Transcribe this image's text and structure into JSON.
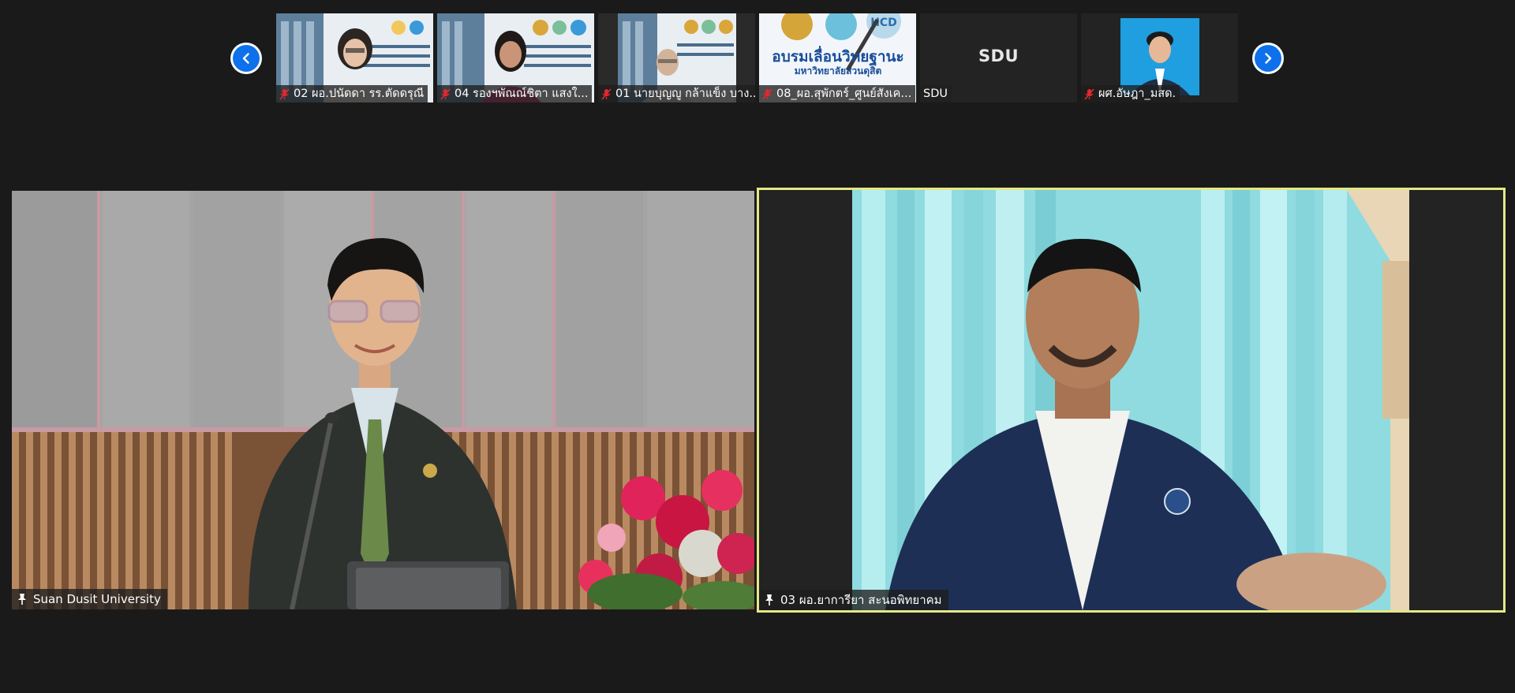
{
  "strip": {
    "prev_label": "Previous",
    "next_label": "Next",
    "thumbnails": [
      {
        "name": "02 ผอ.ปนัดดา รร.ตัดดรุณี",
        "muted": true,
        "type": "video"
      },
      {
        "name": "04 รองฯพัณณ์ชิตา  แสงใ...",
        "muted": true,
        "type": "video"
      },
      {
        "name": "01 นายบุญญู กล้าแข็ง บาง...",
        "muted": true,
        "type": "video"
      },
      {
        "name": "08_ผอ.สุพักตร์_ศูนย์สังเค...",
        "muted": true,
        "type": "video"
      },
      {
        "name": "SDU",
        "muted": false,
        "type": "avatar",
        "avatar_text": "SDU"
      },
      {
        "name": "ผศ.อัษฎา_มสด.",
        "muted": true,
        "type": "photo"
      }
    ],
    "banner_text": "อบรมเลื่อนวิทยฐานะ",
    "banner_sub": "มหาวิทยาลัยสวนดุสิต"
  },
  "main": {
    "left_tile": {
      "name": "Suan Dusit University",
      "pinned": true
    },
    "right_tile": {
      "name": "03 ผอ.ยาการียา สะนอพิทยาคม",
      "pinned": true,
      "active_speaker": true
    }
  },
  "colors": {
    "background": "#1a1a1a",
    "nav_blue": "#0e71eb",
    "active_speaker_border": "#e4e886",
    "mute_red": "#e0282e"
  }
}
